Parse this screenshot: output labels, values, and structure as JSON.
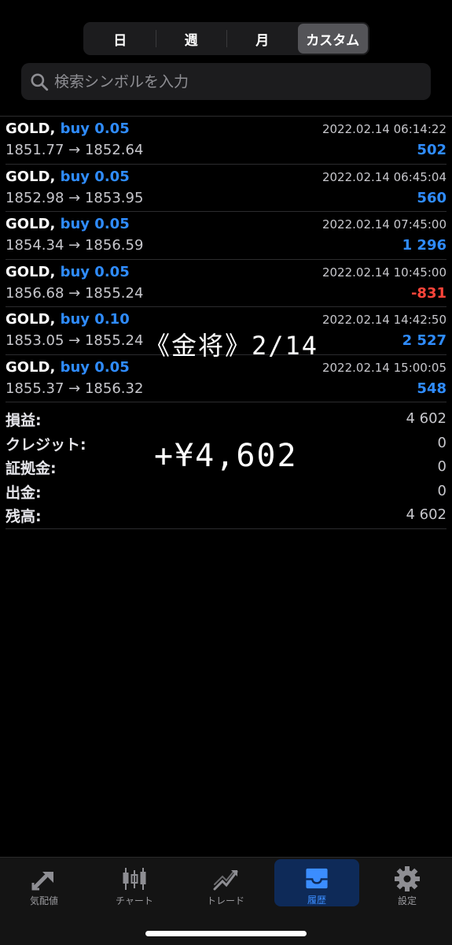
{
  "segmented": {
    "items": [
      {
        "label": "日",
        "active": false
      },
      {
        "label": "週",
        "active": false
      },
      {
        "label": "月",
        "active": false
      },
      {
        "label": "カスタム",
        "active": true
      }
    ]
  },
  "search": {
    "placeholder": "検索シンボルを入力",
    "icon": "search-icon"
  },
  "trades": [
    {
      "symbol": "GOLD,",
      "type": "buy 0.05",
      "time": "2022.02.14 06:14:22",
      "prices": "1851.77 → 1852.64",
      "profit": "502",
      "sign": "pos"
    },
    {
      "symbol": "GOLD,",
      "type": "buy 0.05",
      "time": "2022.02.14 06:45:04",
      "prices": "1852.98 → 1853.95",
      "profit": "560",
      "sign": "pos"
    },
    {
      "symbol": "GOLD,",
      "type": "buy 0.05",
      "time": "2022.02.14 07:45:00",
      "prices": "1854.34 → 1856.59",
      "profit": "1 296",
      "sign": "pos"
    },
    {
      "symbol": "GOLD,",
      "type": "buy 0.05",
      "time": "2022.02.14 10:45:00",
      "prices": "1856.68 → 1855.24",
      "profit": "-831",
      "sign": "neg"
    },
    {
      "symbol": "GOLD,",
      "type": "buy 0.10",
      "time": "2022.02.14 14:42:50",
      "prices": "1853.05 → 1855.24",
      "profit": "2 527",
      "sign": "pos"
    },
    {
      "symbol": "GOLD,",
      "type": "buy 0.05",
      "time": "2022.02.14 15:00:05",
      "prices": "1855.37 → 1856.32",
      "profit": "548",
      "sign": "pos"
    }
  ],
  "summary": [
    {
      "label": "損益:",
      "value": "4 602"
    },
    {
      "label": "クレジット:",
      "value": "0"
    },
    {
      "label": "証拠金:",
      "value": "0"
    },
    {
      "label": "出金:",
      "value": "0"
    },
    {
      "label": "残高:",
      "value": "4 602"
    }
  ],
  "overlay": {
    "title": "《金将》2/14",
    "amount": "+¥4,602"
  },
  "tabbar": {
    "items": [
      {
        "label": "気配値",
        "icon": "quotes-icon",
        "active": false
      },
      {
        "label": "チャート",
        "icon": "candlestick-chart-icon",
        "active": false
      },
      {
        "label": "トレード",
        "icon": "trade-trend-icon",
        "active": false
      },
      {
        "label": "履歴",
        "icon": "history-inbox-icon",
        "active": true
      },
      {
        "label": "設定",
        "icon": "gear-icon",
        "active": false
      }
    ]
  },
  "colors": {
    "accent": "#2f8cff",
    "negative": "#ff453a",
    "background": "#000000"
  }
}
